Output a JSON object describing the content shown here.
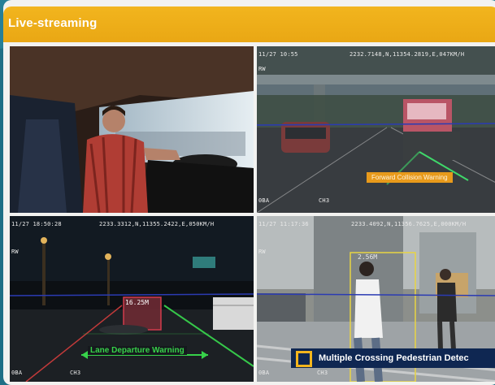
{
  "header": {
    "title": "Live-streaming"
  },
  "tiles": {
    "driver_cam": {},
    "forward_cam": {
      "osd_date": "11/27 10:55",
      "osd_gps": "2232.7148,N,11354.2819,E,047KM/H",
      "osd_left": "RW",
      "osd_bottom_left": "0BA",
      "osd_bottom_mid": "CH3",
      "warning_label": "Forward Collision Warning"
    },
    "lane_cam": {
      "osd_date": "11/27 18:50:28",
      "osd_gps": "2233.3312,N,11355.2422,E,050KM/H",
      "osd_left": "RW",
      "osd_bottom_left": "0BA",
      "osd_bottom_mid": "CH3",
      "distance_label": "16.25M",
      "warning_label": "Lane Departure Warning"
    },
    "pedestrian_cam": {
      "osd_date": "11/27 11:17:36",
      "osd_gps": "2233.4092,N,11356.7625,E,000KM/H",
      "osd_left": "RW",
      "osd_bottom_left": "0BA",
      "osd_bottom_mid": "CH3",
      "distance_label": "2.56M",
      "warning_label": "Multiple Crossing Pedestrian Detec"
    }
  },
  "colors": {
    "header": "#eeae19",
    "background": "#1e6f86",
    "lane_warning": "#37d24a",
    "forward_warning": "#e89a1b",
    "pedestrian_banner": "#0f2752"
  }
}
